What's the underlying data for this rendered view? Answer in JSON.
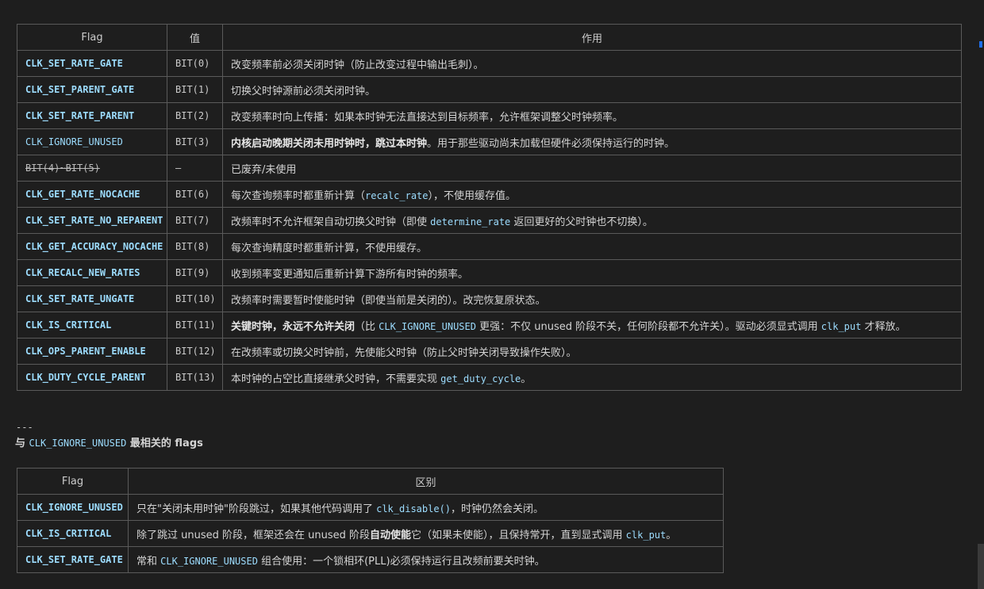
{
  "top_fragment": "",
  "table1": {
    "headers": [
      "Flag",
      "值",
      "作用"
    ],
    "rows": [
      {
        "flag": "CLK_SET_RATE_GATE",
        "value": "BIT(0)",
        "desc": "改变频率前必须关闭时钟（防止改变过程中输出毛刺）。"
      },
      {
        "flag": "CLK_SET_PARENT_GATE",
        "value": "BIT(1)",
        "desc": "切换父时钟源前必须关闭时钟。"
      },
      {
        "flag": "CLK_SET_RATE_PARENT",
        "value": "BIT(2)",
        "desc": "改变频率时向上传播：如果本时钟无法直接达到目标频率，允许框架调整父时钟频率。"
      },
      {
        "flag": "CLK_IGNORE_UNUSED",
        "value": "BIT(3)",
        "desc_bold": "内核启动晚期关闭未用时钟时，跳过本时钟",
        "desc_rest": "。用于那些驱动尚未加载但硬件必须保持运行的时钟。"
      },
      {
        "flag": "BIT(4)~BIT(5)",
        "value": "—",
        "desc": "已废弃/未使用"
      },
      {
        "flag": "CLK_GET_RATE_NOCACHE",
        "value": "BIT(6)",
        "desc_pre": "每次查询频率时都重新计算（",
        "desc_code": "recalc_rate",
        "desc_post": "），不使用缓存值。"
      },
      {
        "flag": "CLK_SET_RATE_NO_REPARENT",
        "value": "BIT(7)",
        "desc_pre": "改频率时不允许框架自动切换父时钟（即使 ",
        "desc_code": "determine_rate",
        "desc_post": " 返回更好的父时钟也不切换）。"
      },
      {
        "flag": "CLK_GET_ACCURACY_NOCACHE",
        "value": "BIT(8)",
        "desc": "每次查询精度时都重新计算，不使用缓存。"
      },
      {
        "flag": "CLK_RECALC_NEW_RATES",
        "value": "BIT(9)",
        "desc": "收到频率变更通知后重新计算下游所有时钟的频率。"
      },
      {
        "flag": "CLK_SET_RATE_UNGATE",
        "value": "BIT(10)",
        "desc": "改频率时需要暂时使能时钟（即使当前是关闭的）。改完恢复原状态。"
      },
      {
        "flag": "CLK_IS_CRITICAL",
        "value": "BIT(11)",
        "desc_bold": "关键时钟，永远不允许关闭",
        "desc_a": "（比 ",
        "desc_code1": "CLK_IGNORE_UNUSED",
        "desc_b": " 更强：不仅 unused 阶段不关，任何阶段都不允许关）。驱动必须显式调用 ",
        "desc_code2": "clk_put",
        "desc_c": " 才释放。"
      },
      {
        "flag": "CLK_OPS_PARENT_ENABLE",
        "value": "BIT(12)",
        "desc": "在改频率或切换父时钟前，先使能父时钟（防止父时钟关闭导致操作失败）。"
      },
      {
        "flag": "CLK_DUTY_CYCLE_PARENT",
        "value": "BIT(13)",
        "desc_pre": "本时钟的占空比直接继承父时钟，不需要实现 ",
        "desc_code": "get_duty_cycle",
        "desc_post": "。"
      }
    ]
  },
  "separator": "---",
  "heading": {
    "pre": "与 ",
    "code": "CLK_IGNORE_UNUSED",
    "post": " 最相关的 flags"
  },
  "table2": {
    "headers": [
      "Flag",
      "区别"
    ],
    "rows": [
      {
        "flag": "CLK_IGNORE_UNUSED",
        "a": "只在\"关闭未用时钟\"阶段跳过，如果其他代码调用了 ",
        "code": "clk_disable()",
        "b": "，时钟仍然会关闭。"
      },
      {
        "flag": "CLK_IS_CRITICAL",
        "a": "除了跳过 unused 阶段，框架还会在 unused 阶段",
        "bold": "自动使能",
        "b": "它（如果未使能），且保持常开，直到显式调用 ",
        "code": "clk_put",
        "c": "。"
      },
      {
        "flag": "CLK_SET_RATE_GATE",
        "a": "常和 ",
        "code": "CLK_IGNORE_UNUSED",
        "b": " 组合使用：一个锁相环(PLL)必须保持运行且改频前要关时钟。"
      }
    ]
  }
}
